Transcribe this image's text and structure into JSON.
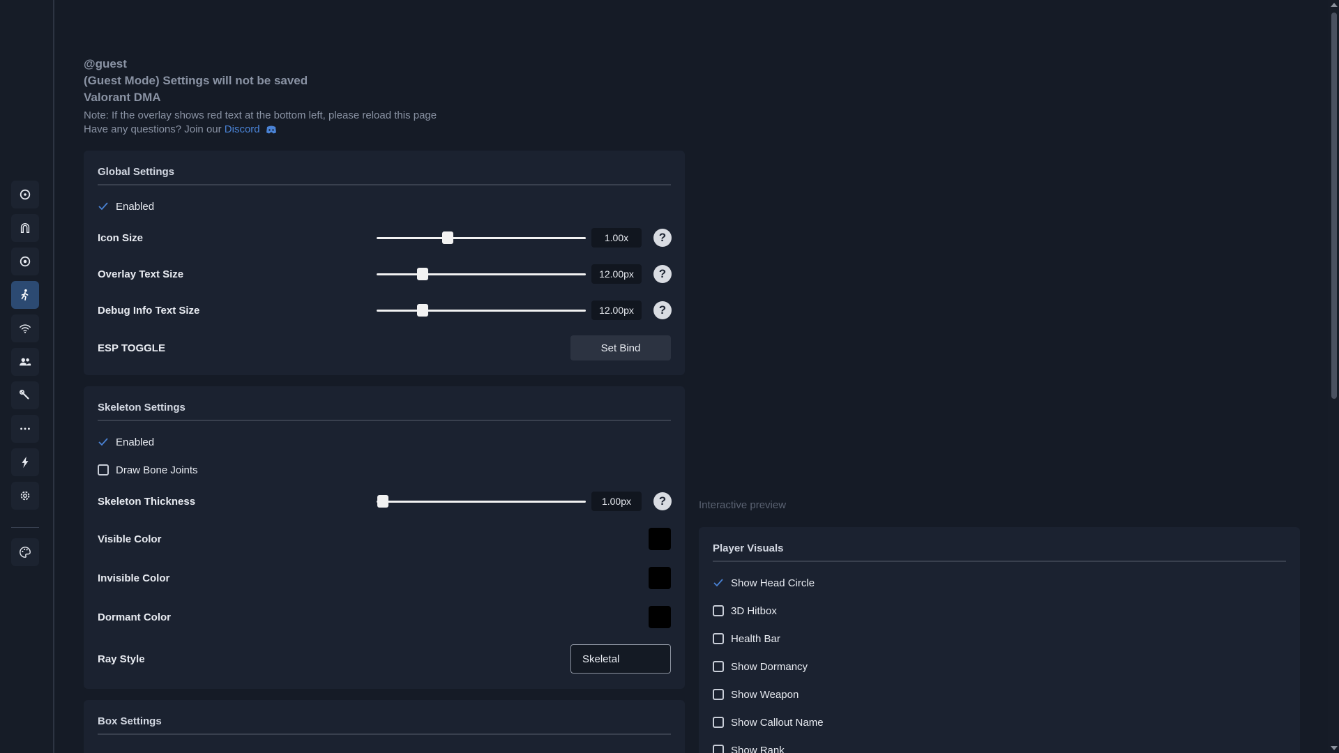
{
  "header": {
    "user": "@guest",
    "mode": "(Guest Mode) Settings will not be saved",
    "product": "Valorant DMA",
    "note": "Note: If the overlay shows red text at the bottom left, please reload this page",
    "question_prefix": "Have any questions? Join our ",
    "discord_link": "Discord"
  },
  "sidebar": {
    "items": [
      {
        "icon": "crosshair-icon"
      },
      {
        "icon": "magnet-icon"
      },
      {
        "icon": "target-icon"
      },
      {
        "icon": "person-running-icon",
        "active": true
      },
      {
        "icon": "wifi-icon"
      },
      {
        "icon": "users-icon"
      },
      {
        "icon": "wrench-icon"
      },
      {
        "icon": "ellipsis-icon"
      },
      {
        "icon": "bolt-icon"
      },
      {
        "icon": "gear-icon"
      },
      {
        "icon": "palette-icon"
      }
    ]
  },
  "global_settings": {
    "title": "Global Settings",
    "enabled_label": "Enabled",
    "enabled": true,
    "icon_size": {
      "label": "Icon Size",
      "value": "1.00x",
      "fraction": 0.34
    },
    "overlay_text_size": {
      "label": "Overlay Text Size",
      "value": "12.00px",
      "fraction": 0.22
    },
    "debug_text_size": {
      "label": "Debug Info Text Size",
      "value": "12.00px",
      "fraction": 0.22
    },
    "esp_toggle": {
      "label": "ESP TOGGLE",
      "button": "Set Bind"
    },
    "help": "?"
  },
  "skeleton_settings": {
    "title": "Skeleton Settings",
    "enabled_label": "Enabled",
    "enabled": true,
    "draw_bone_joints": {
      "label": "Draw Bone Joints",
      "checked": false
    },
    "thickness": {
      "label": "Skeleton Thickness",
      "value": "1.00px",
      "fraction": 0.03
    },
    "visible_color": {
      "label": "Visible Color",
      "color": "#000000"
    },
    "invisible_color": {
      "label": "Invisible Color",
      "color": "#000000"
    },
    "dormant_color": {
      "label": "Dormant Color",
      "color": "#000000"
    },
    "ray_style": {
      "label": "Ray Style",
      "value": "Skeletal"
    },
    "help": "?"
  },
  "box_settings": {
    "title": "Box Settings"
  },
  "preview": {
    "label": "Interactive preview"
  },
  "player_visuals": {
    "title": "Player Visuals",
    "items": [
      {
        "label": "Show Head Circle",
        "checked": true
      },
      {
        "label": "3D Hitbox",
        "checked": false
      },
      {
        "label": "Health Bar",
        "checked": false
      },
      {
        "label": "Show Dormancy",
        "checked": false
      },
      {
        "label": "Show Weapon",
        "checked": false
      },
      {
        "label": "Show Callout Name",
        "checked": false
      },
      {
        "label": "Show Rank",
        "checked": false
      }
    ]
  },
  "colors": {
    "accent": "#4a83d6",
    "active_nav": "#2c4a72",
    "background": "#151b26",
    "panel": "#1b2230"
  }
}
